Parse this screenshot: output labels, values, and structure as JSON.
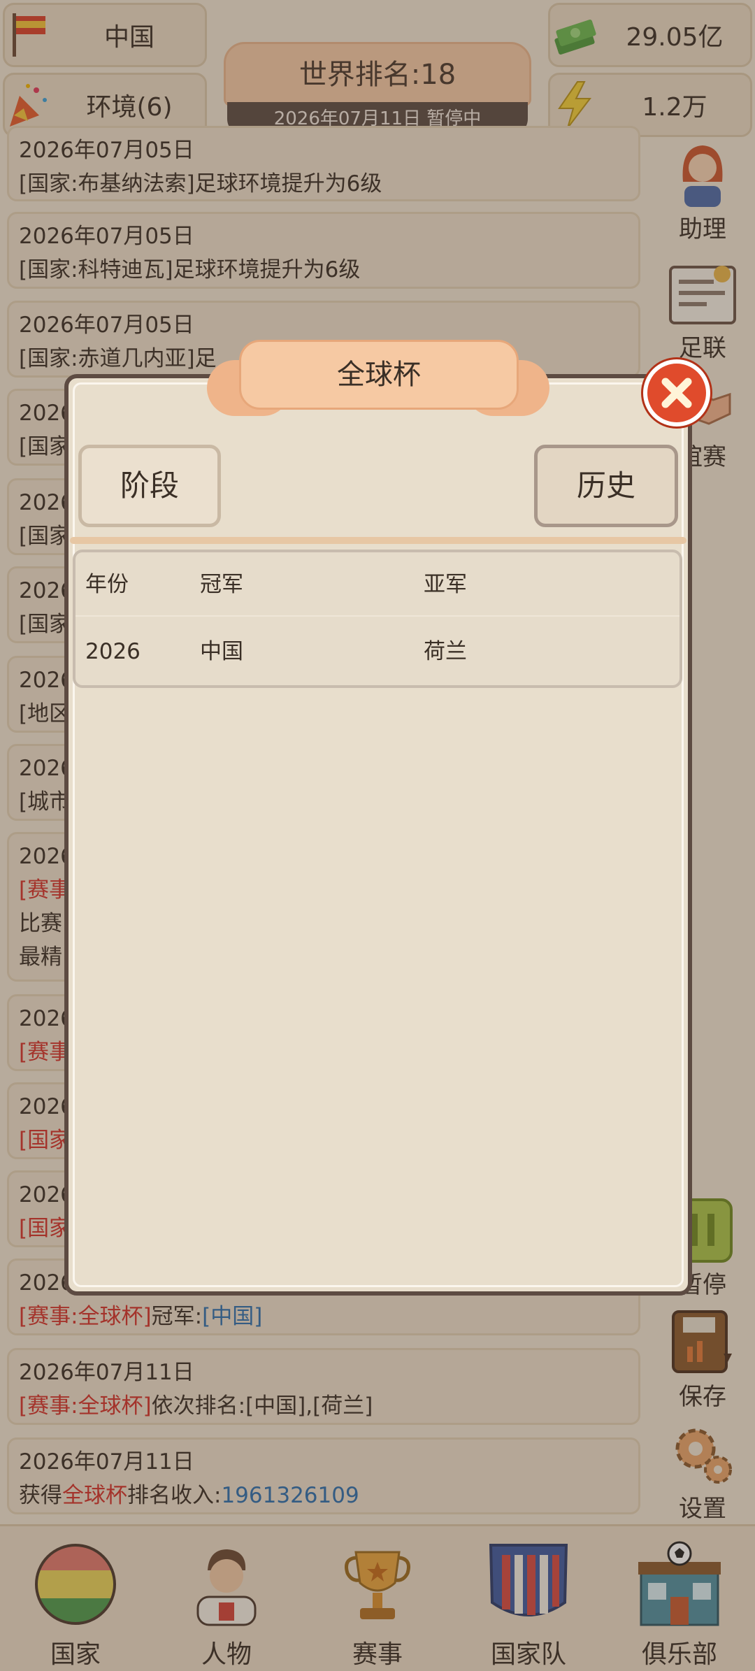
{
  "top": {
    "country": "中国",
    "environment": "环境(6)",
    "money": "29.05亿",
    "energy": "1.2万",
    "world_rank": "世界排名:18",
    "date_status": "2026年07月11日 暂停中"
  },
  "feed": [
    {
      "date": "2026年07月05日",
      "text": "[国家:布基纳法索]足球环境提升为6级"
    },
    {
      "date": "2026年07月05日",
      "text": "[国家:科特迪瓦]足球环境提升为6级"
    },
    {
      "date": "2026年07月05日",
      "text": "[国家:赤道几内亚]足"
    },
    {
      "date": "2026",
      "text": "[国家"
    },
    {
      "date": "2026",
      "text": "[国家"
    },
    {
      "date": "2026",
      "text": "[国家"
    },
    {
      "date": "2026",
      "text": "[地区"
    },
    {
      "date": "2026",
      "text": "[城市"
    },
    {
      "date": "2026",
      "tag": "[赛事",
      "line2": "比赛",
      "line3": "最精"
    },
    {
      "date": "2026",
      "tag": "[赛事"
    },
    {
      "date": "2026",
      "tag": "[国家"
    },
    {
      "date": "2026",
      "tag": "[国家"
    },
    {
      "date": "2026",
      "tag": "[赛事:全球杯]",
      "rest": "冠军:",
      "link": "[中国]"
    },
    {
      "date": "2026年07月11日",
      "tag": "[赛事:全球杯]",
      "rest": "依次排名:[中国],[荷兰]"
    },
    {
      "date": "2026年07月11日",
      "pre": "获得",
      "tag": "全球杯",
      "rest": "排名收入:",
      "link": "1961326109"
    }
  ],
  "side": {
    "assistant": "助理",
    "league": "足联",
    "friendly": "谊赛",
    "pause": "暂停",
    "save": "保存",
    "settings": "设置"
  },
  "nav": [
    "国家",
    "人物",
    "赛事",
    "国家队",
    "俱乐部"
  ],
  "modal": {
    "title": "全球杯",
    "tab_stage": "阶段",
    "tab_history": "历史",
    "table": {
      "headers": [
        "年份",
        "冠军",
        "亚军"
      ],
      "rows": [
        [
          "2026",
          "中国",
          "荷兰"
        ]
      ]
    }
  },
  "colors": {
    "accent_red": "#d2322a",
    "link_blue": "#2c6fae",
    "close_red": "#e04b2c"
  }
}
